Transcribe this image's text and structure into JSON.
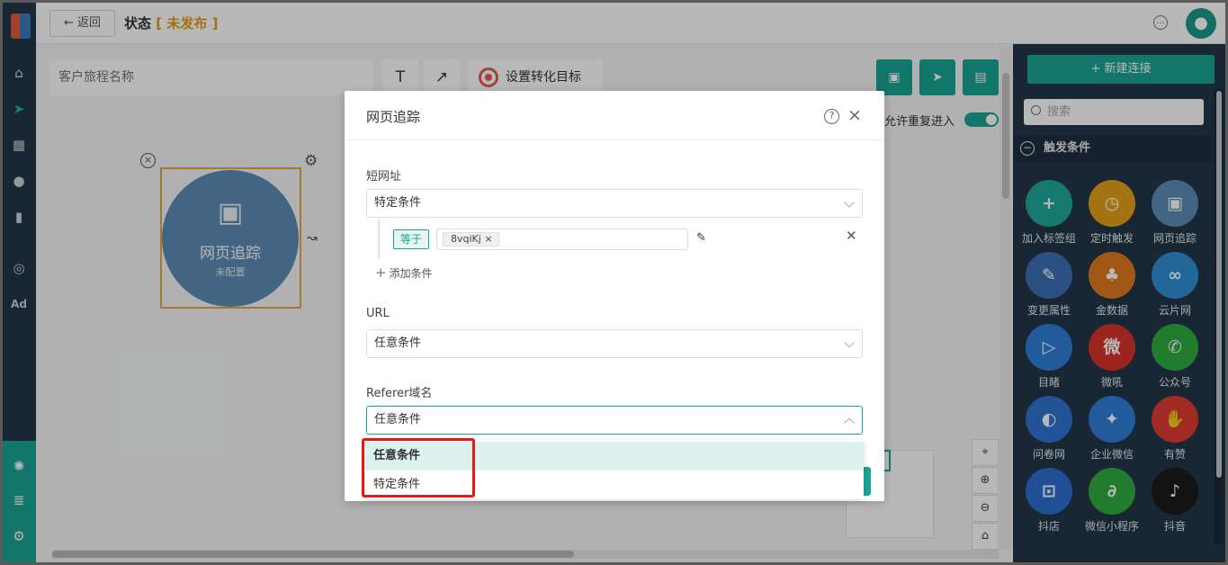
{
  "topbar": {
    "back_label": "返回",
    "title": "状态",
    "status": "未发布"
  },
  "toolbar": {
    "journey_name_placeholder": "客户旅程名称",
    "text_tool": "T",
    "arrow_tool": "↗",
    "goal_label": "设置转化目标"
  },
  "canvas": {
    "node_title": "网页追踪",
    "node_subtitle": "未配置",
    "allow_reentry_label": "允许重复进入"
  },
  "rightpanel": {
    "new_connection": "+ 新建连接",
    "search_placeholder": "搜索",
    "section_title": "触发条件",
    "items": [
      {
        "label": "加入标签组",
        "color": "#1fa89a",
        "glyph": "+"
      },
      {
        "label": "定时触发",
        "color": "#e4a11b",
        "glyph": "◷"
      },
      {
        "label": "网页追踪",
        "color": "#5b8db5",
        "glyph": "▣"
      },
      {
        "label": "变更属性",
        "color": "#3d6fb4",
        "glyph": "✎"
      },
      {
        "label": "金数据",
        "color": "#e07b1c",
        "glyph": "♣"
      },
      {
        "label": "云片网",
        "color": "#2f8fd6",
        "glyph": "∞"
      },
      {
        "label": "目睹",
        "color": "#2f7fd9",
        "glyph": "▷"
      },
      {
        "label": "微吼",
        "color": "#d9332b",
        "glyph": "微"
      },
      {
        "label": "公众号",
        "color": "#2fae3f",
        "glyph": "✆"
      },
      {
        "label": "问卷网",
        "color": "#2f74d0",
        "glyph": "◐"
      },
      {
        "label": "企业微信",
        "color": "#2f7fd9",
        "glyph": "✦"
      },
      {
        "label": "有赞",
        "color": "#e13b34",
        "glyph": "✋"
      },
      {
        "label": "抖店",
        "color": "#2f6ed0",
        "glyph": "⊡"
      },
      {
        "label": "微信小程序",
        "color": "#2fae3f",
        "glyph": "∂"
      },
      {
        "label": "抖音",
        "color": "#1b1b1b",
        "glyph": "♪"
      }
    ]
  },
  "modal": {
    "title": "网页追踪",
    "fields": {
      "short_url": {
        "label": "短网址",
        "value": "特定条件",
        "operator": "等于",
        "chip": "8vqiKj",
        "add_condition": "添加条件"
      },
      "url": {
        "label": "URL",
        "value": "任意条件"
      },
      "referer": {
        "label": "Referer域名",
        "value": "任意条件"
      }
    },
    "dropdown_options": [
      "任意条件",
      "特定条件"
    ]
  },
  "leftnav": {
    "ad_label": "Ad"
  }
}
